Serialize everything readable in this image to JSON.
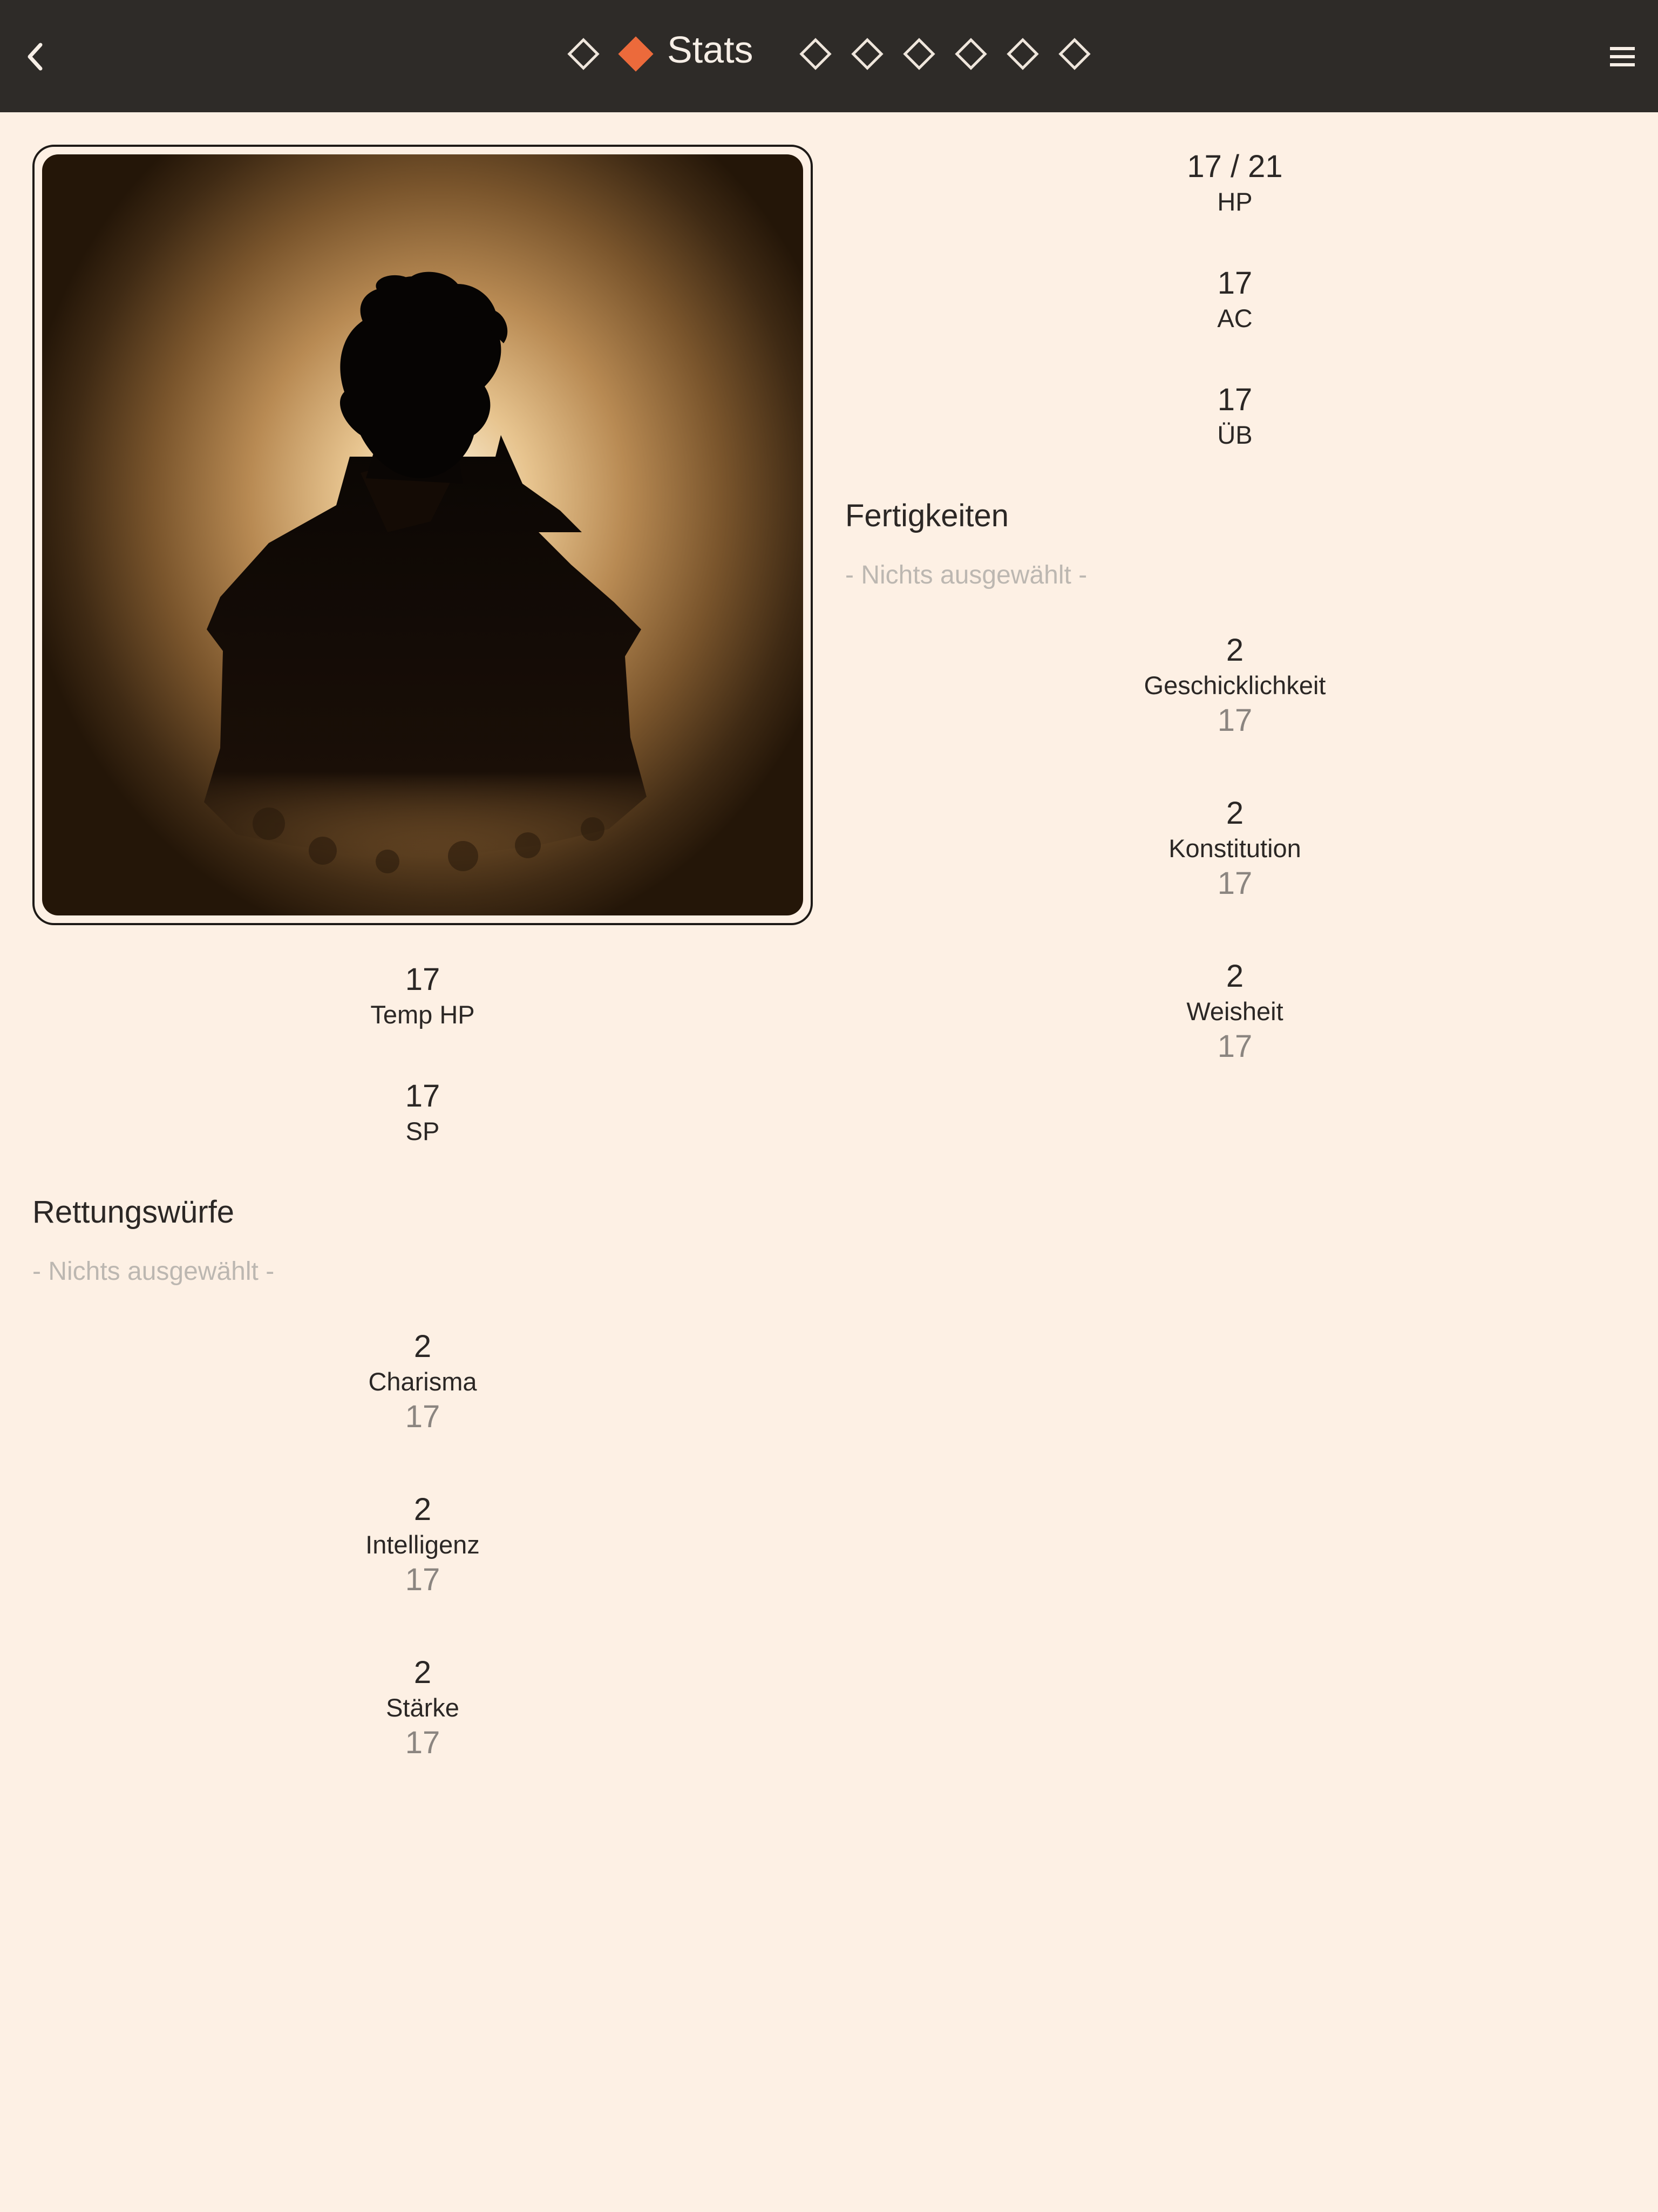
{
  "header": {
    "title": "Stats",
    "back_icon": "chevron-left-icon",
    "menu_icon": "hamburger-menu-icon",
    "page_indicator": {
      "total": 8,
      "active_index": 1
    },
    "colors": {
      "bar": "#2e2b28",
      "active": "#ec6a3b"
    }
  },
  "portrait": {
    "description_icon": "character-silhouette-portrait"
  },
  "top_stats": [
    {
      "value": "17 / 21",
      "label": "HP"
    },
    {
      "value": "17",
      "label": "AC"
    },
    {
      "value": "17",
      "label": "ÜB"
    }
  ],
  "left_stats": [
    {
      "value": "17",
      "label": "Temp HP"
    },
    {
      "value": "17",
      "label": "SP"
    }
  ],
  "skills": {
    "title": "Fertigkeiten",
    "placeholder": "- Nichts ausgewählt -",
    "items": [
      {
        "value": "2",
        "label": "Geschicklichkeit",
        "score": "17"
      },
      {
        "value": "2",
        "label": "Konstitution",
        "score": "17"
      },
      {
        "value": "2",
        "label": "Weisheit",
        "score": "17"
      }
    ]
  },
  "saves": {
    "title": "Rettungswürfe",
    "placeholder": "- Nichts ausgewählt -",
    "items": [
      {
        "value": "2",
        "label": "Charisma",
        "score": "17"
      },
      {
        "value": "2",
        "label": "Intelligenz",
        "score": "17"
      },
      {
        "value": "2",
        "label": "Stärke",
        "score": "17"
      }
    ]
  },
  "colors": {
    "background": "#fdf0e4",
    "text": "#2b2725",
    "muted": "#8b8580",
    "placeholder": "#bcb7b1"
  }
}
